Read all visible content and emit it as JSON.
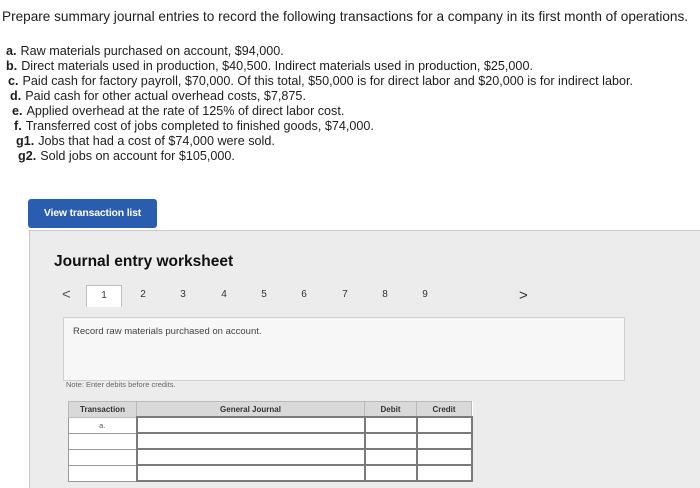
{
  "question": {
    "title": "Prepare summary journal entries to record the following transactions for a company in its first month of operations."
  },
  "transactions": [
    {
      "label": "a.",
      "text": "Raw materials purchased on account, $94,000."
    },
    {
      "label": "b.",
      "text": "Direct materials used in production, $40,500. Indirect materials used in production, $25,000."
    },
    {
      "label": "c.",
      "text": "Paid cash for factory payroll, $70,000. Of this total, $50,000 is for direct labor and $20,000 is for indirect labor."
    },
    {
      "label": "d.",
      "text": "Paid cash for other actual overhead costs, $7,875."
    },
    {
      "label": "e.",
      "text": "Applied overhead at the rate of 125% of direct labor cost."
    },
    {
      "label": "f.",
      "text": "Transferred cost of jobs completed to finished goods, $74,000."
    },
    {
      "label": "g1.",
      "text": "Jobs that had a cost of $74,000 were sold."
    },
    {
      "label": "g2.",
      "text": "Sold jobs on account for $105,000."
    }
  ],
  "view_button": {
    "label": "View transaction list"
  },
  "worksheet": {
    "title": "Journal entry worksheet",
    "prev_arrow": "<",
    "next_arrow": ">",
    "pages": [
      "1",
      "2",
      "3",
      "4",
      "5",
      "6",
      "7",
      "8",
      "9"
    ],
    "active_page": "1",
    "instruction": "Record raw materials purchased on account.",
    "note": "Note: Enter debits before credits.",
    "table": {
      "headers": {
        "transaction": "Transaction",
        "general_journal": "General Journal",
        "debit": "Debit",
        "credit": "Credit"
      },
      "rows": [
        {
          "transaction": "a.",
          "general_journal": "",
          "debit": "",
          "credit": ""
        },
        {
          "transaction": "",
          "general_journal": "",
          "debit": "",
          "credit": ""
        },
        {
          "transaction": "",
          "general_journal": "",
          "debit": "",
          "credit": ""
        },
        {
          "transaction": "",
          "general_journal": "",
          "debit": "",
          "credit": ""
        }
      ]
    }
  }
}
